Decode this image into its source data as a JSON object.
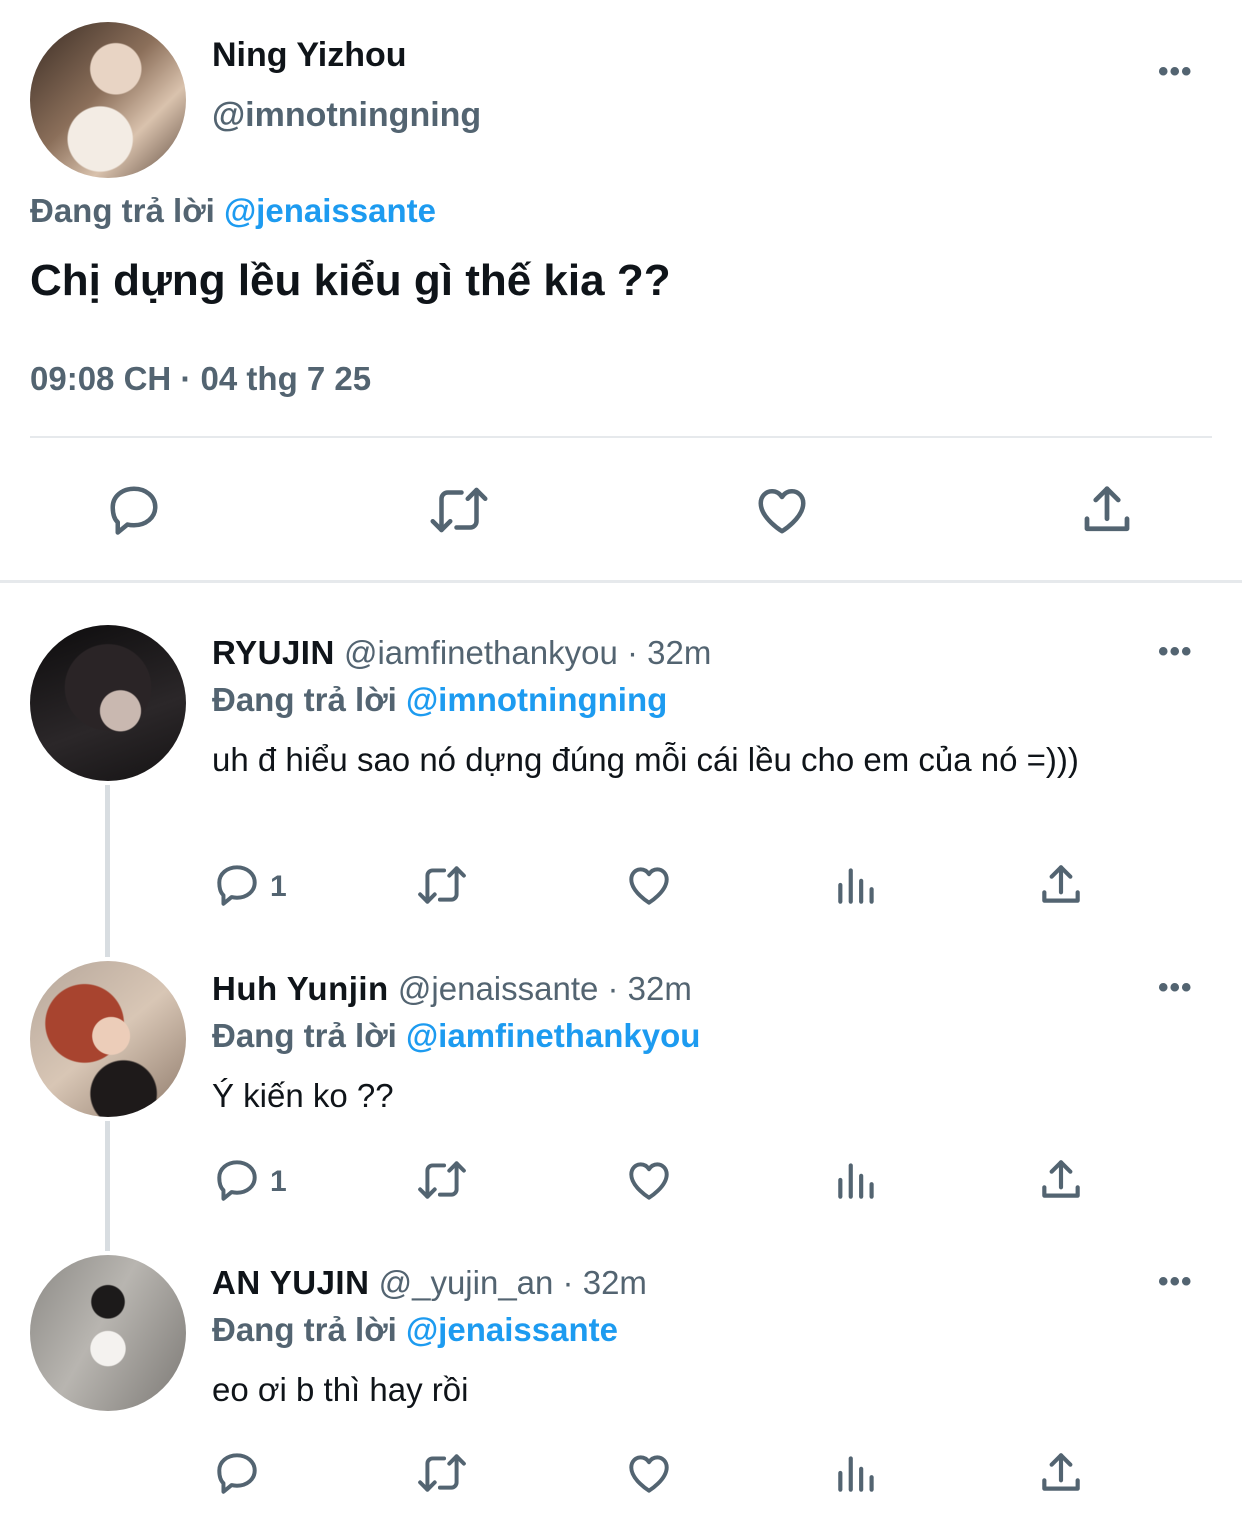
{
  "main_tweet": {
    "display_name": "Ning Yizhou",
    "handle": "@imnotningning",
    "replying_prefix": "Đang trả lời",
    "replying_to": "@jenaissante",
    "text": "Chị dựng lều kiểu gì thế kia ??",
    "timestamp": "09:08 CH · 04 thg 7 25",
    "actions": [
      "reply-icon",
      "retweet-icon",
      "like-icon",
      "share-icon"
    ]
  },
  "replies": [
    {
      "display_name": "RYUJIN",
      "meta": " @iamfinethankyou · 32m",
      "replying_prefix": "Đang trả lời",
      "replying_to": "@imnotningning",
      "text": "uh đ hiểu sao nó dựng đúng mỗi cái lều cho em của nó =)))",
      "reply_count": "1"
    },
    {
      "display_name": "Huh Yunjin",
      "meta": " @jenaissante · 32m",
      "replying_prefix": "Đang trả lời",
      "replying_to": "@iamfinethankyou",
      "text": "Ý kiến ko ??",
      "reply_count": "1"
    },
    {
      "display_name": "AN YUJIN",
      "meta": " @_yujin_an · 32m",
      "replying_prefix": "Đang trả lời",
      "replying_to": "@jenaissante",
      "text": "eo ơi b thì hay rồi",
      "reply_count": ""
    }
  ],
  "more_label": "•••",
  "colors": {
    "accent": "#1d9bf0",
    "muted": "#536471",
    "text": "#0f1419"
  }
}
